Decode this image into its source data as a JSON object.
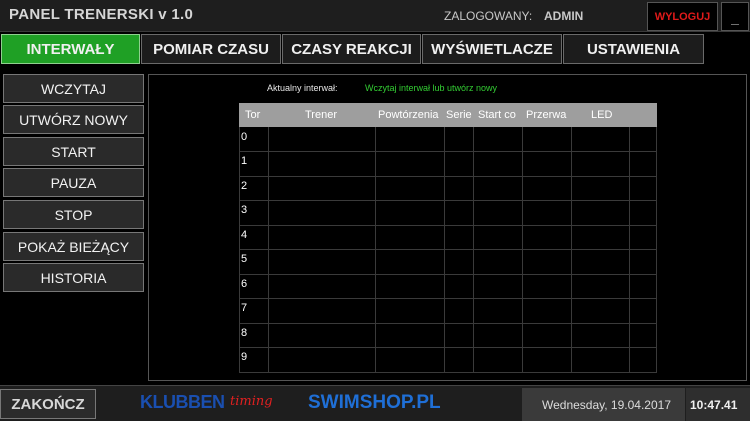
{
  "header": {
    "title": "PANEL TRENERSKI v 1.0",
    "login_label": "ZALOGOWANY:",
    "login_user": "ADMIN",
    "logout_label": "WYLOGUJ",
    "minimize_label": "_"
  },
  "tabs": [
    {
      "label": "INTERWAŁY"
    },
    {
      "label": "POMIAR CZASU"
    },
    {
      "label": "CZASY REAKCJI"
    },
    {
      "label": "WYŚWIETLACZE"
    },
    {
      "label": "USTAWIENIA"
    }
  ],
  "sidebar": {
    "items": [
      {
        "label": "WCZYTAJ"
      },
      {
        "label": "UTWÓRZ NOWY"
      },
      {
        "label": "START"
      },
      {
        "label": "PAUZA"
      },
      {
        "label": "STOP"
      },
      {
        "label": "POKAŻ BIEŻĄCY"
      },
      {
        "label": "HISTORIA"
      }
    ]
  },
  "main": {
    "current_label": "Aktualny interwał:",
    "current_value": "Wczytaj interwał lub utwórz nowy",
    "columns": [
      "Tor",
      "Trener",
      "Powtórzenia",
      "Serie",
      "Start co",
      "Przerwa",
      "LED"
    ],
    "rows": [
      "0",
      "1",
      "2",
      "3",
      "4",
      "5",
      "6",
      "7",
      "8",
      "9"
    ]
  },
  "footer": {
    "exit_label": "ZAKOŃCZ",
    "logo_klubben": "KLUBBEN",
    "logo_timing": "timing",
    "logo_swimshop": "SWIMSHOP.PL",
    "date": "Wednesday, 19.04.2017",
    "time": "10:47.41"
  },
  "colors": {
    "active_tab": "#1fa025",
    "logout": "#e01a1a",
    "status_text": "#33cc33",
    "table_header": "#9e9e9e"
  }
}
